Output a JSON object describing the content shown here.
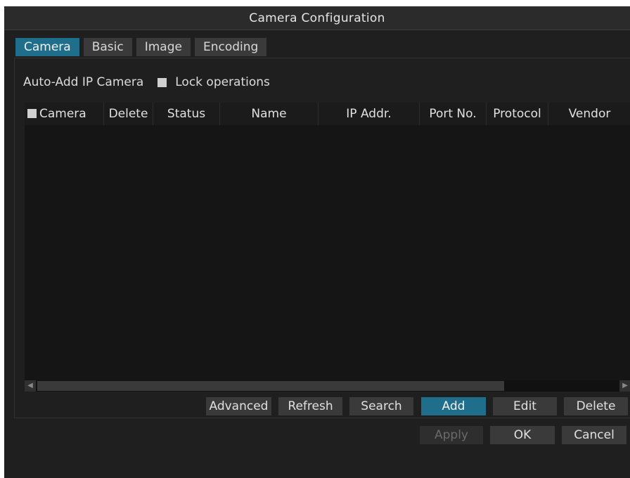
{
  "window": {
    "title": "Camera Configuration"
  },
  "tabs": [
    {
      "label": "Camera",
      "active": true
    },
    {
      "label": "Basic",
      "active": false
    },
    {
      "label": "Image",
      "active": false
    },
    {
      "label": "Encoding",
      "active": false
    }
  ],
  "options": {
    "auto_add_label": "Auto-Add IP Camera",
    "lock_label": "Lock operations",
    "lock_checked": false
  },
  "table": {
    "columns": [
      "Camera",
      "Delete",
      "Status",
      "Name",
      "IP Addr.",
      "Port No.",
      "Protocol",
      "Vendor"
    ],
    "select_all_checked": false,
    "rows": []
  },
  "actions": {
    "advanced": "Advanced",
    "refresh": "Refresh",
    "search": "Search",
    "add": "Add",
    "edit": "Edit",
    "delete": "Delete"
  },
  "footer": {
    "apply": "Apply",
    "ok": "OK",
    "cancel": "Cancel"
  },
  "colors": {
    "accent": "#1f6f8c",
    "background": "#1f1f1f",
    "button": "#3a3a3a"
  }
}
